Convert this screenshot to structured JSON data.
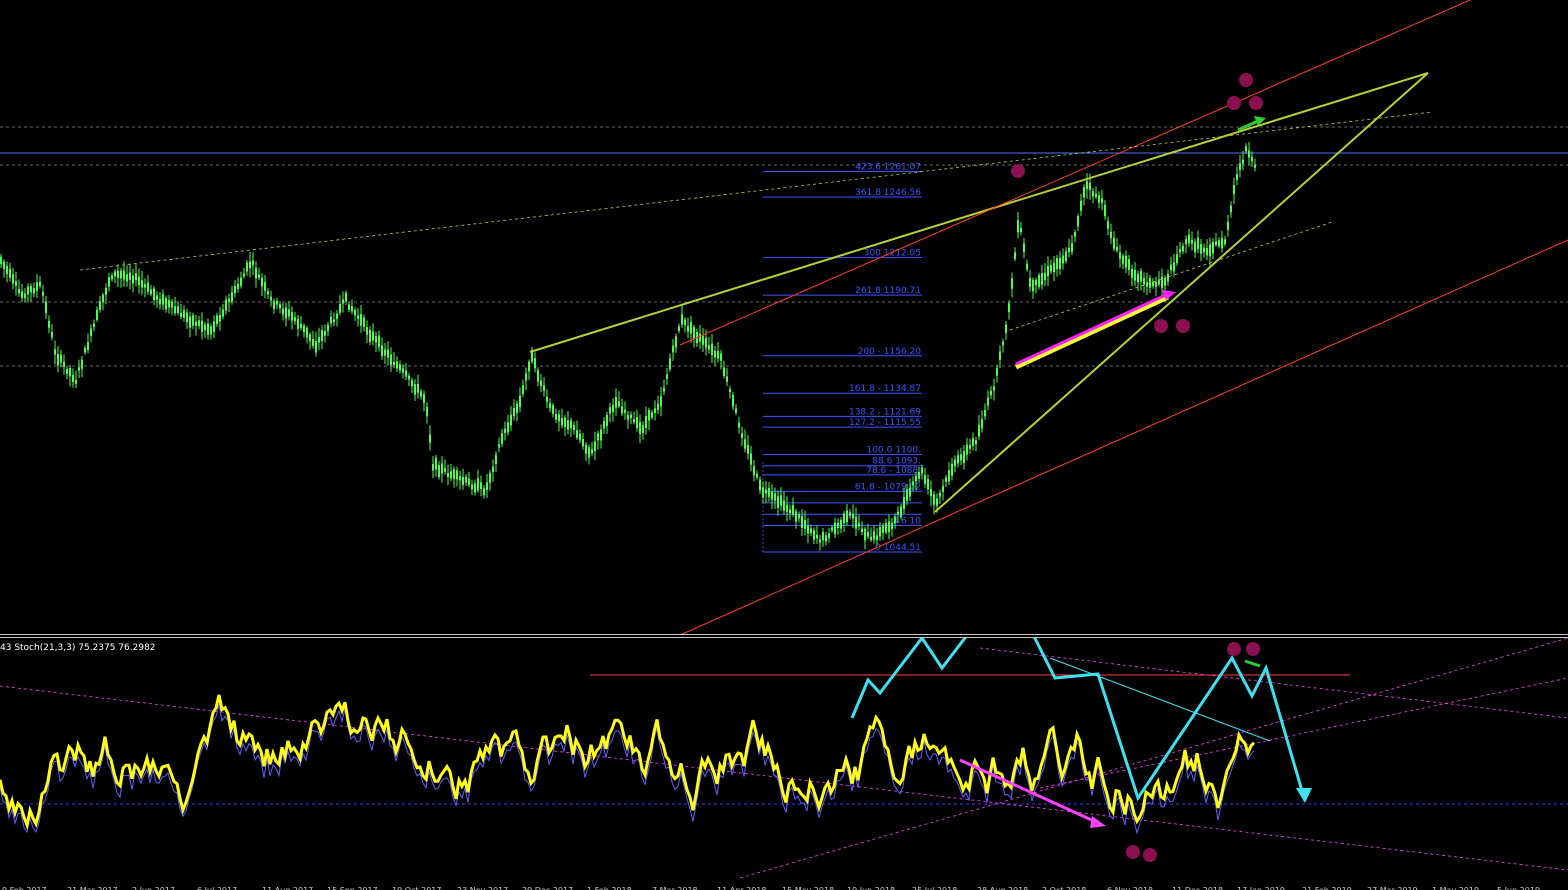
{
  "main_pane": {
    "fibonacci_levels": [
      {
        "label": "423.6 1261.07",
        "price": 1261.07
      },
      {
        "label": "361.8 1246.56",
        "price": 1246.56
      },
      {
        "label": "300 1212.05",
        "price": 1212.05
      },
      {
        "label": "261.8 1190.71",
        "price": 1190.71
      },
      {
        "label": "200 - 1156.20",
        "price": 1156.2
      },
      {
        "label": "161.8 - 1134.87",
        "price": 1134.87
      },
      {
        "label": "138.2 - 1121.69",
        "price": 1121.69
      },
      {
        "label": "127.2 - 1115.55",
        "price": 1115.55
      },
      {
        "label": "100.0 1100.",
        "price": 1100.0
      },
      {
        "label": "88.6 1093.",
        "price": 1093.6
      },
      {
        "label": "78.6 - 1088.",
        "price": 1088.4
      },
      {
        "label": "61.8 - 1079.02",
        "price": 1079.02
      },
      {
        "label": "",
        "price": 1072.5
      },
      {
        "label": "",
        "price": 1066.0
      },
      {
        "label": "3.6 10",
        "price": 1059.6
      },
      {
        "label": "0 1044.51",
        "price": 1044.51
      }
    ],
    "colors": {
      "candles": "#4cff4c",
      "fibonacci": "#3b56ff",
      "trendline": "#b4d232",
      "channel": "#ff4020",
      "marker": "#8b1050",
      "arrow_magenta": "#ff20ff",
      "arrow_green": "#32cd32",
      "grid_dash": "#8a8a8a",
      "horizontal": "#5070ff"
    }
  },
  "indicator_pane": {
    "label": "43  Stoch(21,3,3) 75.2375 76.2982",
    "stoch_k": 75.2375,
    "stoch_d": 76.2982,
    "colors": {
      "k_line": "#ffff1a",
      "d_line": "#6060ff",
      "signal": "#ff40ff",
      "pattern": "#3fe0f0",
      "level": "#ff4040"
    }
  },
  "time_axis": {
    "tick_labels": [
      "9 Feb 2017",
      "21 Mar 2017",
      "2 Jun 2017",
      "6 Jul 2017",
      "11 Aug 2017",
      "15 Sep 2017",
      "19 Oct 2017",
      "23 Nov 2017",
      "29 Dec 2017",
      "1 Feb 2018",
      "7 Mar 2018",
      "11 Apr 2018",
      "15 May 2018",
      "19 Jun 2018",
      "25 Jul 2018",
      "28 Aug 2018",
      "2 Oct 2018",
      "6 Nov 2018",
      "11 Dec 2018",
      "17 Jan 2019",
      "21 Feb 2019",
      "27 Mar 2019",
      "1 May 2019",
      "5 Jun 2019"
    ]
  }
}
